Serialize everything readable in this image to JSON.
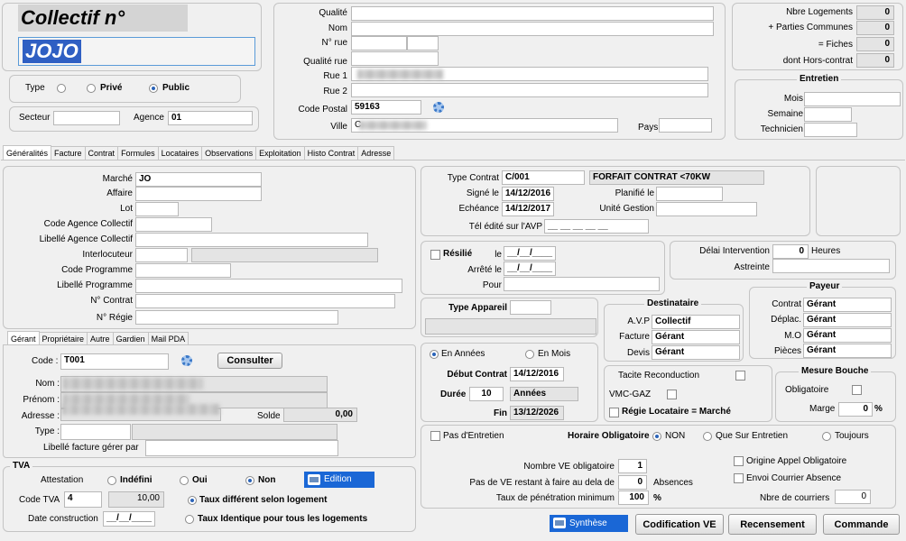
{
  "header": {
    "title": "Collectif n°",
    "code": "JOJO"
  },
  "type_group": {
    "label": "Type",
    "prive": "Privé",
    "public": "Public",
    "selected": "public"
  },
  "secteur": {
    "label": "Secteur",
    "value": ""
  },
  "agence": {
    "label": "Agence",
    "value": "01"
  },
  "address": {
    "qualite": "Qualité",
    "nom": "Nom",
    "num_rue": "N° rue",
    "qualite_rue": "Qualité rue",
    "rue1": "Rue 1",
    "rue2": "Rue 2",
    "code_postal": "Code Postal",
    "code_postal_value": "59163",
    "ville": "Ville",
    "ville_value": "C",
    "pays": "Pays"
  },
  "counts": {
    "nbre_logements": "Nbre Logements",
    "nbre_logements_value": "0",
    "parties_communes": "+ Parties Communes",
    "parties_communes_value": "0",
    "fiches": "= Fiches",
    "fiches_value": "0",
    "hors_contrat": "dont Hors-contrat",
    "hors_contrat_value": "0"
  },
  "entretien": {
    "title": "Entretien",
    "mois": "Mois",
    "semaine": "Semaine",
    "technicien": "Technicien"
  },
  "main_tabs": [
    "Généralités",
    "Facture",
    "Contrat",
    "Formules",
    "Locataires",
    "Observations",
    "Exploitation",
    "Histo Contrat",
    "Adresse"
  ],
  "generalites": {
    "marche": "Marché",
    "marche_value": "JO",
    "affaire": "Affaire",
    "lot": "Lot",
    "code_agence": "Code Agence Collectif",
    "libelle_agence": "Libellé Agence Collectif",
    "interlocuteur": "Interlocuteur",
    "code_programme": "Code Programme",
    "libelle_programme": "Libellé Programme",
    "num_contrat": "N° Contrat",
    "num_regie": "N° Régie"
  },
  "contrat": {
    "type_label": "Type Contrat",
    "type_value": "C/001",
    "type_desc": "FORFAIT CONTRAT <70KW",
    "signe_label": "Signé le",
    "signe_value": "14/12/2016",
    "planifie_label": "Planifié le",
    "echeance_label": "Echéance",
    "echeance_value": "14/12/2017",
    "unite_label": "Unité Gestion",
    "tel_label": "Tél édité sur l'AVP",
    "tel_value": "__ __ __ __ __"
  },
  "resilie": {
    "label": "Résilié",
    "le": "le",
    "le_value": "__/__/____",
    "arrete": "Arrêté le",
    "arrete_value": "__/__/____",
    "pour": "Pour"
  },
  "delai": {
    "label": "Délai Intervention",
    "value": "0",
    "unit": "Heures",
    "astreinte": "Astreinte"
  },
  "appareil": {
    "label": "Type Appareil"
  },
  "destinataire": {
    "title": "Destinataire",
    "avp": "A.V.P",
    "avp_value": "Collectif",
    "facture": "Facture",
    "facture_value": "Gérant",
    "devis": "Devis",
    "devis_value": "Gérant"
  },
  "payeur": {
    "title": "Payeur",
    "contrat": "Contrat",
    "contrat_value": "Gérant",
    "deplac": "Déplac.",
    "deplac_value": "Gérant",
    "mo": "M.O",
    "mo_value": "Gérant",
    "pieces": "Pièces",
    "pieces_value": "Gérant"
  },
  "duree_box": {
    "en_annees": "En Années",
    "en_mois": "En Mois",
    "selected": "annees",
    "debut_label": "Début Contrat",
    "debut_value": "14/12/2016",
    "duree_label": "Durée",
    "duree_value": "10",
    "duree_unit": "Années",
    "fin_label": "Fin",
    "fin_value": "13/12/2026"
  },
  "options_box": {
    "tacite": "Tacite Reconduction",
    "vmc": "VMC-GAZ",
    "regie": "Régie Locataire = Marché"
  },
  "mesure_bouche": {
    "title": "Mesure Bouche",
    "obligatoire": "Obligatoire",
    "marge": "Marge",
    "marge_value": "0",
    "pct": "%"
  },
  "gerant_tabs": [
    "Gérant",
    "Propriétaire",
    "Autre",
    "Gardien",
    "Mail PDA"
  ],
  "gerant": {
    "code_label": "Code :",
    "code_value": "T001",
    "consulter": "Consulter",
    "nom": "Nom :",
    "prenom": "Prénom :",
    "adresse": "Adresse :",
    "solde": "Solde",
    "solde_value": "0,00",
    "type": "Type :",
    "libelle": "Libellé facture gérer par"
  },
  "tva": {
    "title": "TVA",
    "attestation": "Attestation",
    "indefini": "Indéfini",
    "oui": "Oui",
    "non": "Non",
    "selected": "non",
    "edition": "Edition",
    "code_label": "Code TVA",
    "code_value": "4",
    "rate_value": "10,00",
    "taux_diff": "Taux différent selon logement",
    "taux_ident": "Taux Identique pour tous les logements",
    "taux_selected": "diff",
    "date_label": "Date construction",
    "date_value": "__/__/____"
  },
  "entretien_box": {
    "pas_entretien": "Pas d'Entretien",
    "horaire": "Horaire Obligatoire",
    "non": "NON",
    "que_sur": "Que Sur Entretien",
    "toujours": "Toujours",
    "horaire_selected": "non",
    "nombre_ve": "Nombre VE obligatoire",
    "nombre_ve_value": "1",
    "pas_de_ve": "Pas de VE restant à faire au dela de",
    "pas_de_ve_value": "0",
    "absences": "Absences",
    "taux_pen": "Taux de pénétration minimum",
    "taux_pen_value": "100",
    "pct": "%",
    "origine": "Origine Appel Obligatoire",
    "envoi": "Envoi Courrier Absence",
    "nbre_courriers": "Nbre de courriers",
    "nbre_courriers_value": "0"
  },
  "bottom_buttons": {
    "synthese": "Synthèse",
    "codification": "Codification VE",
    "recensement": "Recensement",
    "commande": "Commande"
  }
}
